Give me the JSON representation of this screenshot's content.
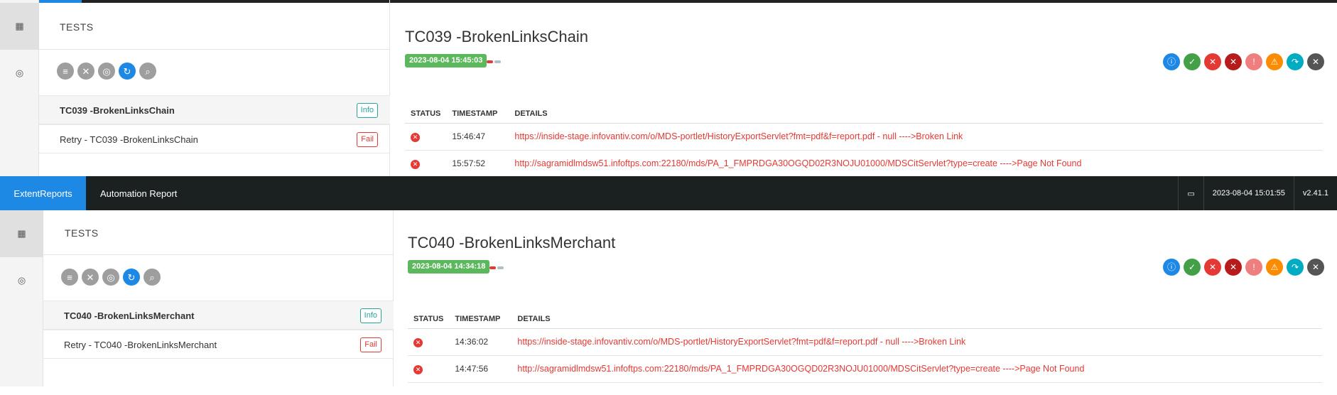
{
  "sidebar": {
    "dashboard_icon": "dashboard-icon",
    "tests_icon": "target-icon"
  },
  "toolbar_icons": [
    "list-icon",
    "close-icon",
    "target-icon",
    "refresh-icon",
    "search-icon"
  ],
  "filter_icons": [
    {
      "name": "info-filter",
      "icon": "i",
      "color": "#1e88e5"
    },
    {
      "name": "pass-filter",
      "icon": "✓",
      "color": "#43a047"
    },
    {
      "name": "fail-filter",
      "icon": "✕",
      "color": "#e53935"
    },
    {
      "name": "fatal-filter",
      "icon": "✕",
      "color": "#c62828"
    },
    {
      "name": "error-filter",
      "icon": "!",
      "color": "#ef7f7f"
    },
    {
      "name": "warning-filter",
      "icon": "!",
      "color": "#fb8c00"
    },
    {
      "name": "skip-filter",
      "icon": "↷",
      "color": "#00acc1"
    },
    {
      "name": "clear-filter",
      "icon": "✕",
      "color": "#555555"
    }
  ],
  "table_headers": {
    "status": "STATUS",
    "timestamp": "TIMESTAMP",
    "details": "DETAILS"
  },
  "panel_top": {
    "tests_label": "TESTS",
    "test_items": [
      {
        "name": "TC039 -BrokenLinksChain",
        "badge": "Info"
      },
      {
        "name": "Retry - TC039 -BrokenLinksChain",
        "badge": "Fail"
      }
    ],
    "title": "TC039 -BrokenLinksChain",
    "timestamp_badge": "2023-08-04 15:45:03",
    "logs": [
      {
        "time": "15:46:47",
        "details": "https://inside-stage.infovantiv.com/o/MDS-portlet/HistoryExportServlet?fmt=pdf&f=report.pdf - null ---->Broken Link"
      },
      {
        "time": "15:57:52",
        "details": "http://sagramidlmdsw51.infoftps.com:22180/mds/PA_1_FMPRDGA30OGQD02R3NOJU01000/MDSCitServlet?type=create ---->Page Not Found"
      }
    ]
  },
  "navbar": {
    "brand": "ExtentReports",
    "title": "Automation Report",
    "monitor_icon": "monitor-icon",
    "datetime": "2023-08-04 15:01:55",
    "version": "v2.41.1"
  },
  "panel_bottom": {
    "tests_label": "TESTS",
    "test_items": [
      {
        "name": "TC040 -BrokenLinksMerchant",
        "badge": "Info"
      },
      {
        "name": "Retry - TC040 -BrokenLinksMerchant",
        "badge": "Fail"
      }
    ],
    "title": "TC040 -BrokenLinksMerchant",
    "timestamp_badge": "2023-08-04 14:34:18",
    "logs": [
      {
        "time": "14:36:02",
        "details": "https://inside-stage.infovantiv.com/o/MDS-portlet/HistoryExportServlet?fmt=pdf&f=report.pdf - null ---->Broken Link"
      },
      {
        "time": "14:47:56",
        "details": "http://sagramidlmdsw51.infoftps.com:22180/mds/PA_1_FMPRDGA30OGQD02R3NOJU01000/MDSCitServlet?type=create ---->Page Not Found"
      }
    ]
  }
}
